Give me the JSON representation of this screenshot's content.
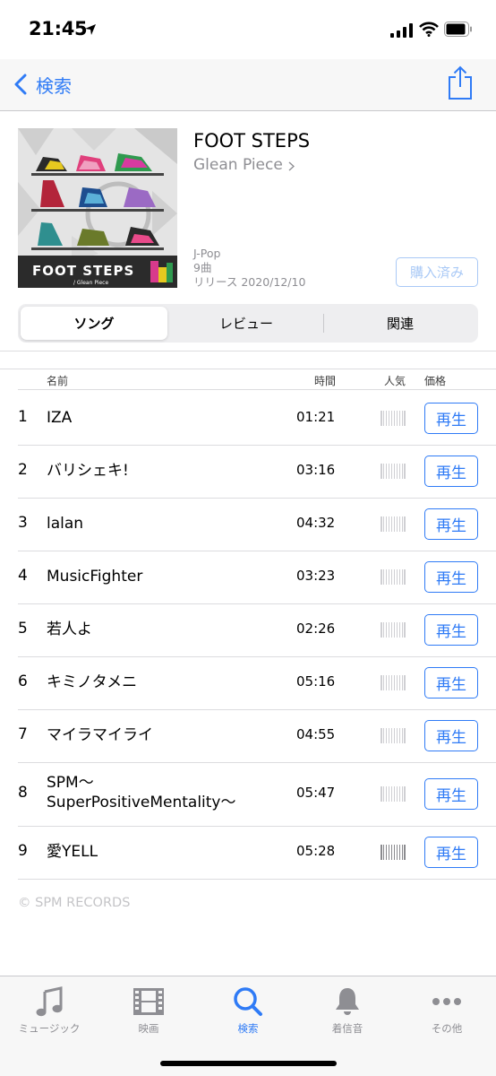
{
  "status_bar": {
    "time": "21:45"
  },
  "nav": {
    "back_label": "検索"
  },
  "album": {
    "cover_title": "FOOT STEPS",
    "cover_artist": "/ Glean Piece",
    "title": "FOOT STEPS",
    "artist": "Glean Piece",
    "genre": "J-Pop",
    "track_count": "9曲",
    "release": "リリース 2020/12/10",
    "purchased_label": "購入済み"
  },
  "segments": {
    "songs": "ソング",
    "reviews": "レビュー",
    "related": "関連"
  },
  "columns": {
    "name": "名前",
    "time": "時間",
    "popularity": "人気",
    "price": "価格"
  },
  "tracks": [
    {
      "num": "1",
      "name": "IZA",
      "time": "01:21",
      "play": "再生",
      "popularity": "low"
    },
    {
      "num": "2",
      "name": "バリシェキ!",
      "time": "03:16",
      "play": "再生",
      "popularity": "low"
    },
    {
      "num": "3",
      "name": "lalan",
      "time": "04:32",
      "play": "再生",
      "popularity": "low"
    },
    {
      "num": "4",
      "name": "MusicFighter",
      "time": "03:23",
      "play": "再生",
      "popularity": "low"
    },
    {
      "num": "5",
      "name": "若人よ",
      "time": "02:26",
      "play": "再生",
      "popularity": "low"
    },
    {
      "num": "6",
      "name": "キミノタメニ",
      "time": "05:16",
      "play": "再生",
      "popularity": "low"
    },
    {
      "num": "7",
      "name": "マイラマイライ",
      "time": "04:55",
      "play": "再生",
      "popularity": "low"
    },
    {
      "num": "8",
      "name": "SPM〜\nSuperPositiveMentality〜",
      "time": "05:47",
      "play": "再生",
      "popularity": "low"
    },
    {
      "num": "9",
      "name": "愛YELL",
      "time": "05:28",
      "play": "再生",
      "popularity": "high"
    }
  ],
  "copyright": "© SPM RECORDS",
  "tabs": [
    {
      "label": "ミュージック",
      "icon": "music-note-icon"
    },
    {
      "label": "映画",
      "icon": "film-icon"
    },
    {
      "label": "検索",
      "icon": "search-icon"
    },
    {
      "label": "着信音",
      "icon": "bell-icon"
    },
    {
      "label": "その他",
      "icon": "more-icon"
    }
  ],
  "colors": {
    "accent": "#2f7bf6",
    "secondary_text": "#8e8e93"
  }
}
